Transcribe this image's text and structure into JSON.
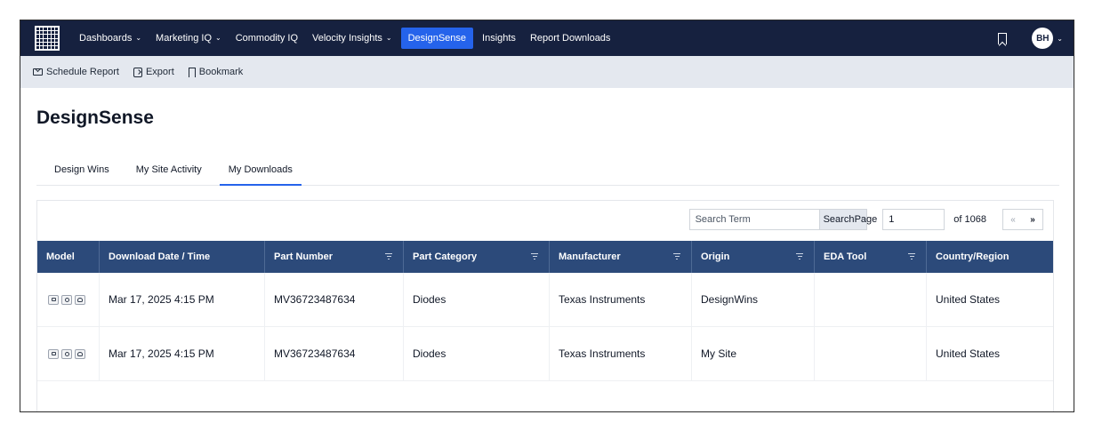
{
  "nav": {
    "items": [
      {
        "label": "Dashboards",
        "has_menu": true
      },
      {
        "label": "Marketing IQ",
        "has_menu": true
      },
      {
        "label": "Commodity IQ",
        "has_menu": false
      },
      {
        "label": "Velocity Insights",
        "has_menu": true
      },
      {
        "label": "DesignSense",
        "has_menu": false,
        "active": true
      },
      {
        "label": "Insights",
        "has_menu": false
      },
      {
        "label": "Report Downloads",
        "has_menu": false
      }
    ],
    "user_initials": "BH",
    "chevron": "⌄",
    "icons": [
      "grid-logo-icon",
      "bookmark-icon",
      "chevron-down-icon"
    ],
    "bg_color": "#16213f",
    "active_color": "#2563eb"
  },
  "subbar": {
    "schedule_label": "Schedule Report",
    "export_label": "Export",
    "bookmark_label": "Bookmark",
    "icons": [
      "envelope-icon",
      "export-icon",
      "bookmark-icon"
    ]
  },
  "page": {
    "title": "DesignSense"
  },
  "tabs": [
    {
      "label": "Design Wins",
      "active": false
    },
    {
      "label": "My Site Activity",
      "active": false
    },
    {
      "label": "My Downloads",
      "active": true
    }
  ],
  "toolbar": {
    "search_placeholder": "Search Term",
    "search_button": "Search",
    "page_label": "Page",
    "page_value": "1",
    "of_label": "of 1068",
    "prev": "«",
    "next": "»"
  },
  "table": {
    "header_color": "#2c4a7a",
    "columns": [
      {
        "label": "Model",
        "filter": false
      },
      {
        "label": "Download Date / Time",
        "filter": false
      },
      {
        "label": "Part Number",
        "filter": true
      },
      {
        "label": "Part Category",
        "filter": true
      },
      {
        "label": "Manufacturer",
        "filter": true
      },
      {
        "label": "Origin",
        "filter": true
      },
      {
        "label": "EDA Tool",
        "filter": true
      },
      {
        "label": "Country/Region",
        "filter": false
      }
    ],
    "rows": [
      {
        "datetime": "Mar 17, 2025 4:15 PM",
        "part_number": "MV36723487634",
        "category": "Diodes",
        "manufacturer": "Texas Instruments",
        "origin": "DesignWins",
        "eda_tool": "",
        "country": "United States"
      },
      {
        "datetime": "Mar 17, 2025 4:15 PM",
        "part_number": "MV36723487634",
        "category": "Diodes",
        "manufacturer": "Texas Instruments",
        "origin": "My Site",
        "eda_tool": "",
        "country": "United States"
      }
    ]
  }
}
